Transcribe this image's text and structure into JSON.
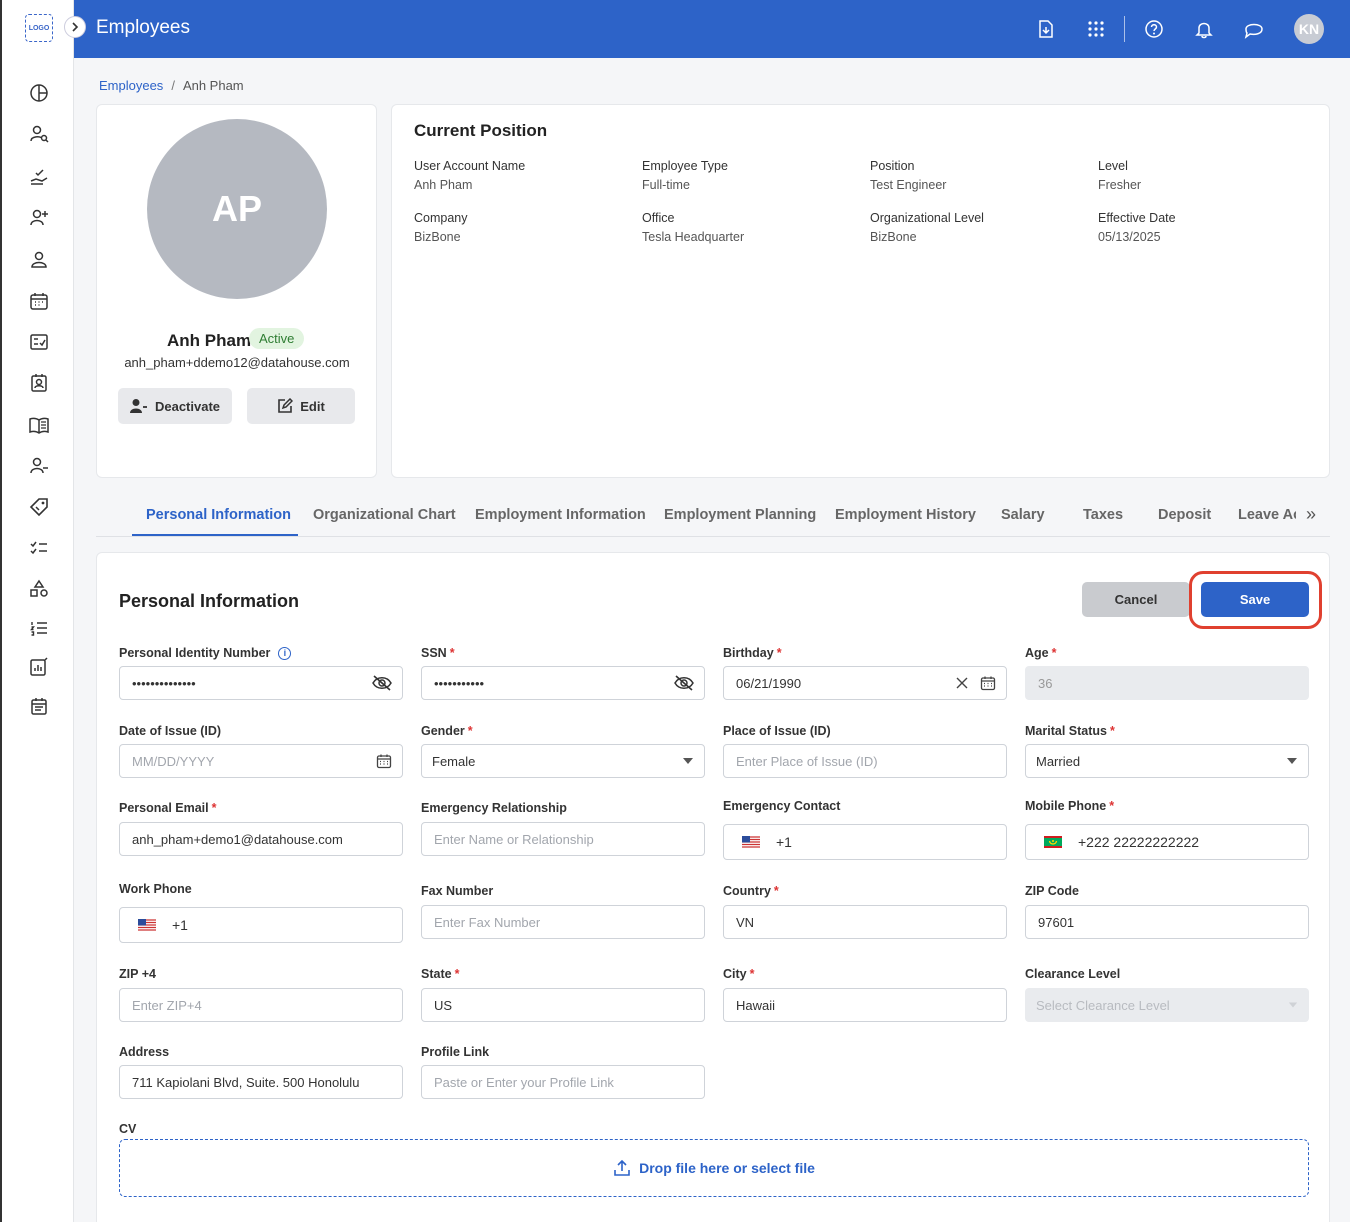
{
  "app": {
    "logo_text": "LOGO",
    "title": "Employees",
    "user_initials": "KN",
    "accent": "#2d63c8"
  },
  "sidebar": {
    "items": [
      "dashboard-icon",
      "user-search-icon",
      "hand-check-icon",
      "user-add-icon",
      "user-icon",
      "calendar-icon",
      "checklist-icon",
      "contact-card-icon",
      "book-icon",
      "user-remove-icon",
      "tag-icon",
      "task-list-icon",
      "shapes-icon",
      "ordered-list-icon",
      "report-icon",
      "schedule-icon"
    ]
  },
  "breadcrumb": {
    "root": "Employees",
    "separator": "/",
    "current": "Anh Pham"
  },
  "profile": {
    "initials": "AP",
    "name": "Anh Pham",
    "status": "Active",
    "email": "anh_pham+ddemo12@datahouse.com",
    "deactivate_label": "Deactivate",
    "edit_label": "Edit"
  },
  "position": {
    "title": "Current Position",
    "fields": [
      {
        "label": "User Account Name",
        "value": "Anh Pham"
      },
      {
        "label": "Employee Type",
        "value": "Full-time"
      },
      {
        "label": "Position",
        "value": "Test Engineer"
      },
      {
        "label": "Level",
        "value": "Fresher"
      },
      {
        "label": "Company",
        "value": "BizBone"
      },
      {
        "label": "Office",
        "value": "Tesla Headquarter"
      },
      {
        "label": "Organizational Level",
        "value": "BizBone"
      },
      {
        "label": "Effective Date",
        "value": "05/13/2025"
      }
    ]
  },
  "tabs": [
    "Personal Information",
    "Organizational Chart",
    "Employment Information",
    "Employment Planning",
    "Employment History",
    "Salary",
    "Taxes",
    "Deposit",
    "Leave Ac"
  ],
  "form": {
    "title": "Personal Information",
    "cancel_label": "Cancel",
    "save_label": "Save",
    "pin": {
      "label": "Personal Identity Number",
      "value": "••••••••••••••"
    },
    "ssn": {
      "label": "SSN",
      "value": "•••••••••••"
    },
    "birthday": {
      "label": "Birthday",
      "value": "06/21/1990"
    },
    "age": {
      "label": "Age",
      "value": "36"
    },
    "date_of_issue": {
      "label": "Date of Issue (ID)",
      "placeholder": "MM/DD/YYYY"
    },
    "gender": {
      "label": "Gender",
      "value": "Female"
    },
    "place_of_issue": {
      "label": "Place of Issue (ID)",
      "placeholder": "Enter Place of Issue (ID)"
    },
    "marital_status": {
      "label": "Marital Status",
      "value": "Married"
    },
    "personal_email": {
      "label": "Personal Email",
      "value": "anh_pham+demo1@datahouse.com"
    },
    "emergency_relationship": {
      "label": "Emergency Relationship",
      "placeholder": "Enter Name or Relationship"
    },
    "emergency_contact": {
      "label": "Emergency Contact",
      "value": "+1"
    },
    "mobile_phone": {
      "label": "Mobile Phone",
      "value": "+222 22222222222"
    },
    "work_phone": {
      "label": "Work Phone",
      "value": "+1"
    },
    "fax": {
      "label": "Fax Number",
      "placeholder": "Enter Fax Number"
    },
    "country": {
      "label": "Country",
      "value": "VN"
    },
    "zip": {
      "label": "ZIP Code",
      "value": "97601"
    },
    "zip4": {
      "label": "ZIP +4",
      "placeholder": "Enter ZIP+4"
    },
    "state": {
      "label": "State",
      "value": "US"
    },
    "city": {
      "label": "City",
      "value": "Hawaii"
    },
    "clearance": {
      "label": "Clearance Level",
      "placeholder": "Select Clearance Level"
    },
    "address": {
      "label": "Address",
      "value": "711 Kapiolani Blvd, Suite. 500 Honolulu"
    },
    "profile_link": {
      "label": "Profile Link",
      "placeholder": "Paste or Enter your Profile Link"
    },
    "cv": {
      "label": "CV",
      "drop_text": "Drop file here or select file"
    }
  }
}
